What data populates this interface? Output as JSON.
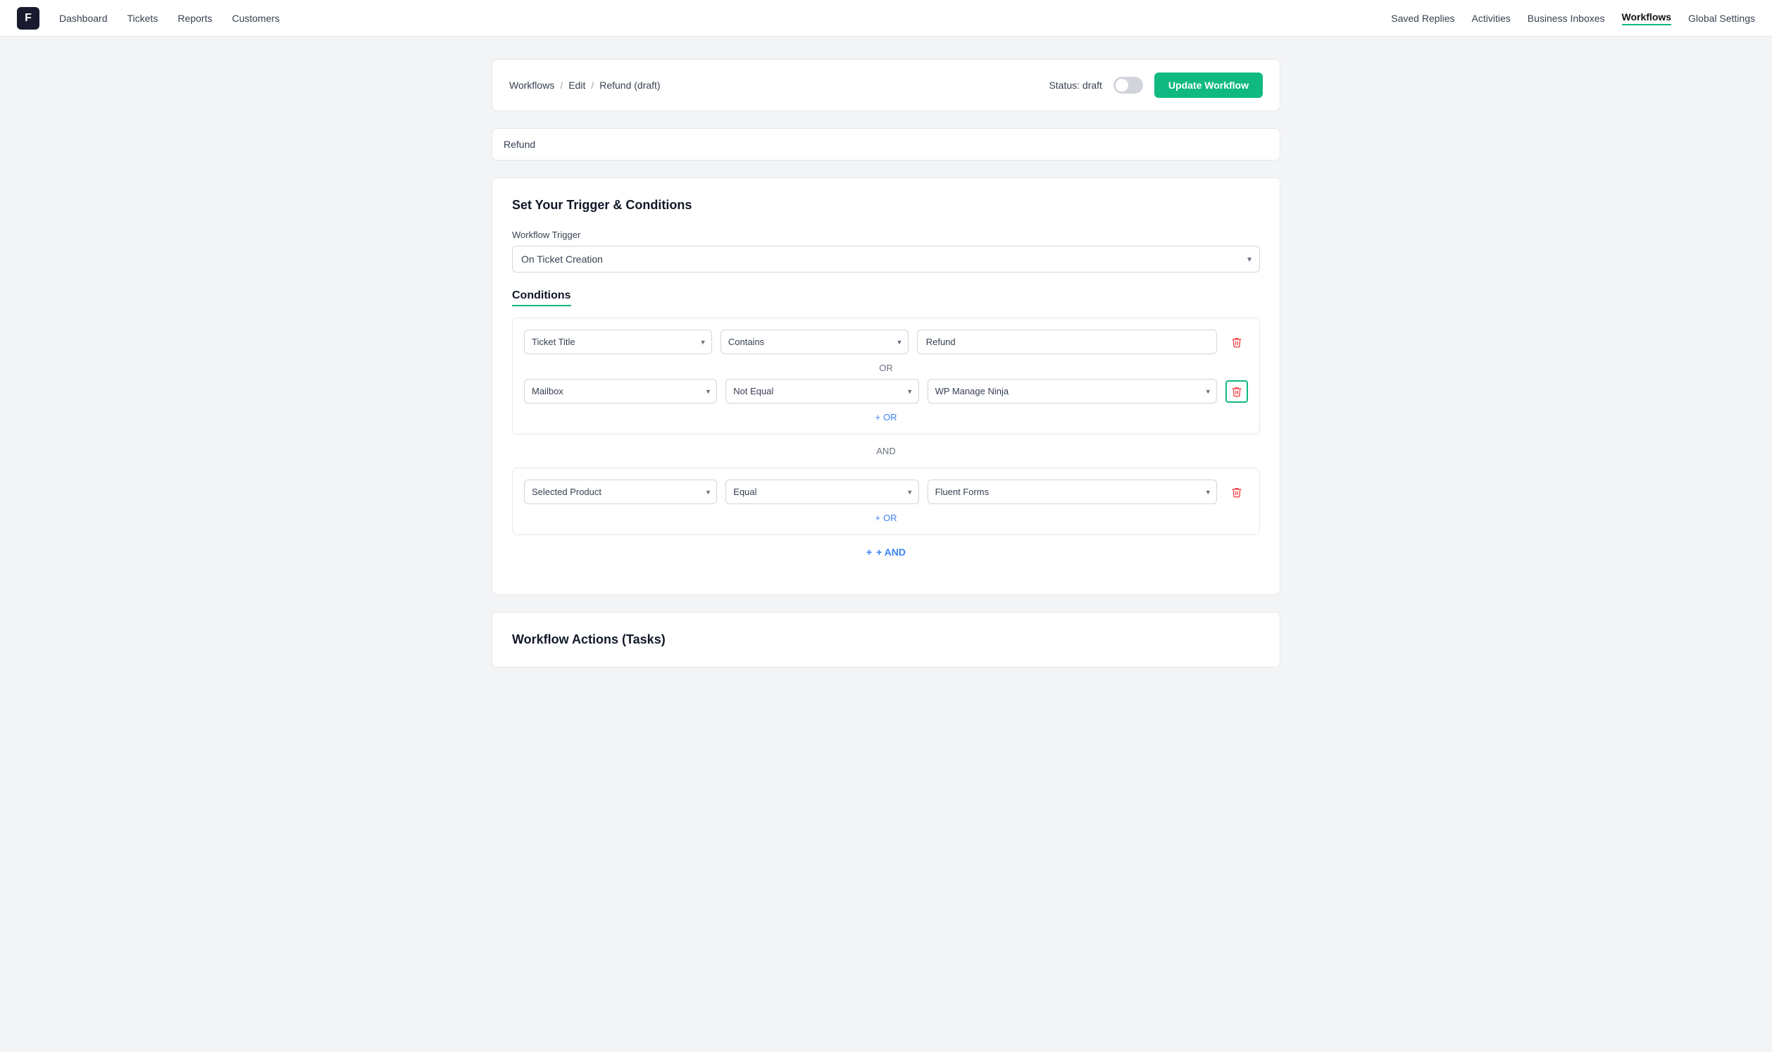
{
  "app": {
    "logo": "F",
    "nav_links": [
      {
        "label": "Dashboard",
        "active": false
      },
      {
        "label": "Tickets",
        "active": false
      },
      {
        "label": "Reports",
        "active": false
      },
      {
        "label": "Customers",
        "active": false
      }
    ],
    "right_links": [
      {
        "label": "Saved Replies",
        "active": false
      },
      {
        "label": "Activities",
        "active": false
      },
      {
        "label": "Business Inboxes",
        "active": false
      },
      {
        "label": "Workflows",
        "active": true
      },
      {
        "label": "Global Settings",
        "active": false
      }
    ]
  },
  "breadcrumb": {
    "items": [
      "Workflows",
      "Edit",
      "Refund (draft)"
    ]
  },
  "status": {
    "label": "Status: draft"
  },
  "update_button": "Update Workflow",
  "workflow_name": "Refund",
  "section_trigger": {
    "title": "Set Your Trigger & Conditions",
    "trigger_label": "Workflow Trigger",
    "trigger_value": "On Ticket Creation"
  },
  "conditions_label": "Conditions",
  "condition_groups": [
    {
      "rows": [
        {
          "field": "Ticket Title",
          "operator": "Contains",
          "value_type": "text",
          "value": "Refund"
        },
        {
          "or_separator": "OR",
          "field": "Mailbox",
          "operator": "Not Equal",
          "value_type": "select",
          "value": "WP Manage Ninja",
          "delete_highlighted": true
        }
      ],
      "add_or_label": "+ OR"
    }
  ],
  "and_separator": "AND",
  "condition_groups_2": [
    {
      "rows": [
        {
          "field": "Selected Product",
          "operator": "Equal",
          "value_type": "select",
          "value": "Fluent Forms",
          "delete_highlighted": false
        }
      ],
      "add_or_label": "+ OR"
    }
  ],
  "add_and_label": "+ AND",
  "workflow_actions_title": "Workflow Actions (Tasks)"
}
